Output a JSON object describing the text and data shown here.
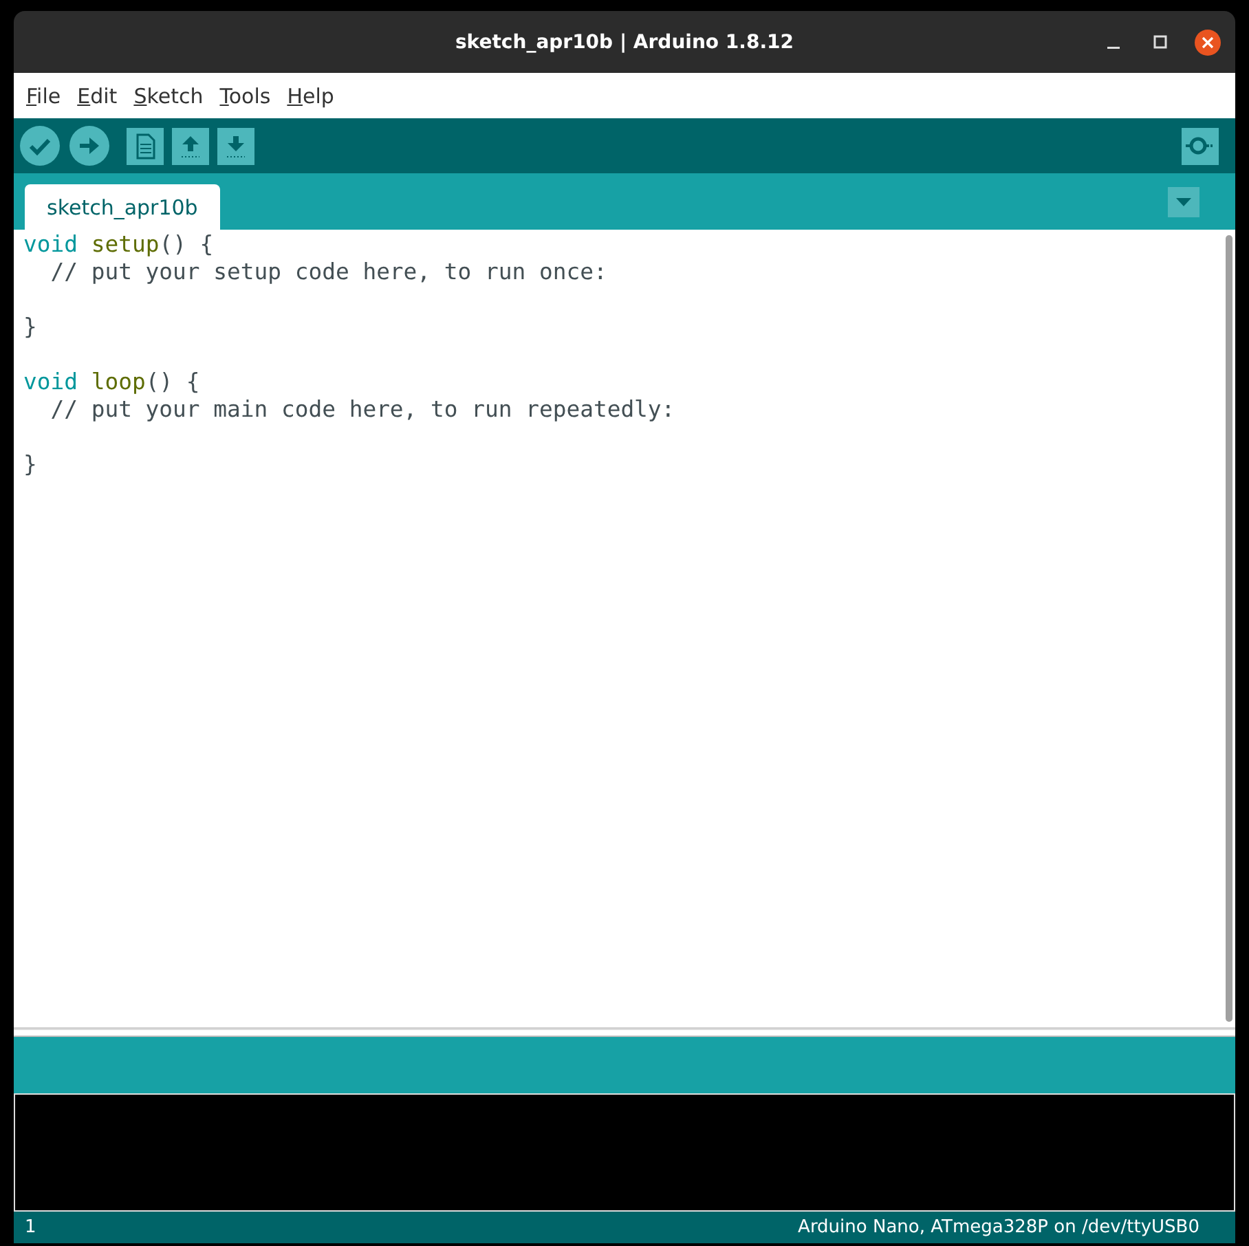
{
  "window": {
    "title": "sketch_apr10b | Arduino 1.8.12"
  },
  "menu": [
    {
      "label": "File"
    },
    {
      "label": "Edit"
    },
    {
      "label": "Sketch"
    },
    {
      "label": "Tools"
    },
    {
      "label": "Help"
    }
  ],
  "tabs": [
    {
      "label": "sketch_apr10b",
      "selected": true
    }
  ],
  "editor": {
    "lines": [
      {
        "kind": "code",
        "tokens": [
          {
            "text": "void",
            "kind": "keyword"
          },
          {
            "text": " setup",
            "kind": "function"
          },
          {
            "text": "() {",
            "kind": "plain"
          }
        ]
      },
      {
        "kind": "code",
        "tokens": [
          {
            "text": "  // put your setup code here, to run once:",
            "kind": "comment"
          }
        ]
      },
      {
        "kind": "blank"
      },
      {
        "kind": "code",
        "tokens": [
          {
            "text": "}",
            "kind": "plain"
          }
        ]
      },
      {
        "kind": "blank"
      },
      {
        "kind": "code",
        "tokens": [
          {
            "text": "void",
            "kind": "keyword"
          },
          {
            "text": " loop",
            "kind": "function"
          },
          {
            "text": "() {",
            "kind": "plain"
          }
        ]
      },
      {
        "kind": "code",
        "tokens": [
          {
            "text": "  // put your main code here, to run repeatedly:",
            "kind": "comment"
          }
        ]
      },
      {
        "kind": "blank"
      },
      {
        "kind": "code",
        "tokens": [
          {
            "text": "}",
            "kind": "plain"
          }
        ]
      }
    ]
  },
  "status_bar": {
    "line": "1",
    "board": "Arduino Nano, ATmega328P on /dev/ttyUSB0"
  }
}
